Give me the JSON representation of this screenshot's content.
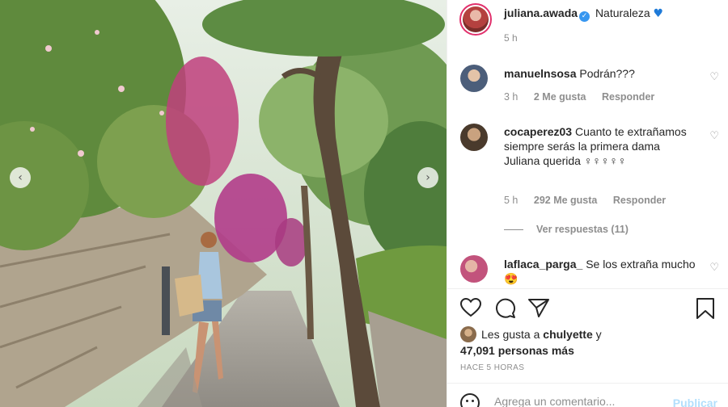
{
  "post": {
    "username": "juliana.awada",
    "verified_glyph": "✓",
    "caption": "Naturaleza",
    "caption_emoji": "♥",
    "time_ago": "5 h",
    "photo_icon_names": {
      "prev": "chevron-left-icon",
      "next": "chevron-right-icon"
    },
    "nav_prev_glyph": "‹",
    "nav_next_glyph": "›"
  },
  "comments": [
    {
      "username": "manuelnsosa",
      "text": "Podrán???",
      "time": "3 h",
      "likes": "2 Me gusta",
      "reply": "Responder"
    },
    {
      "username": "cocaperez03",
      "text": "Cuanto te extrañamos siempre serás la primera dama Juliana querida ♀♀♀♀♀",
      "time": "5 h",
      "likes": "292 Me gusta",
      "reply": "Responder",
      "view_replies": "Ver respuestas (11)"
    },
    {
      "username": "laflaca_parga_",
      "text": "Se los extraña mucho",
      "emoji": "😍"
    }
  ],
  "like_glyph": "♡",
  "actions": {
    "like_icon": "heart-icon",
    "comment_icon": "comment-icon",
    "share_icon": "share-icon",
    "save_icon": "bookmark-icon"
  },
  "likes_summary": {
    "prefix": "Les gusta a",
    "user": "chulyette",
    "connector": "y",
    "count": "47,091 personas más"
  },
  "post_timestamp": "HACE 5 HORAS",
  "add_comment": {
    "placeholder": "Agrega un comentario...",
    "publish_label": "Publicar"
  },
  "colors": {
    "accent_blue": "#3897f0",
    "publish_disabled": "#b2dffc",
    "muted_text": "#8e8e8e"
  }
}
